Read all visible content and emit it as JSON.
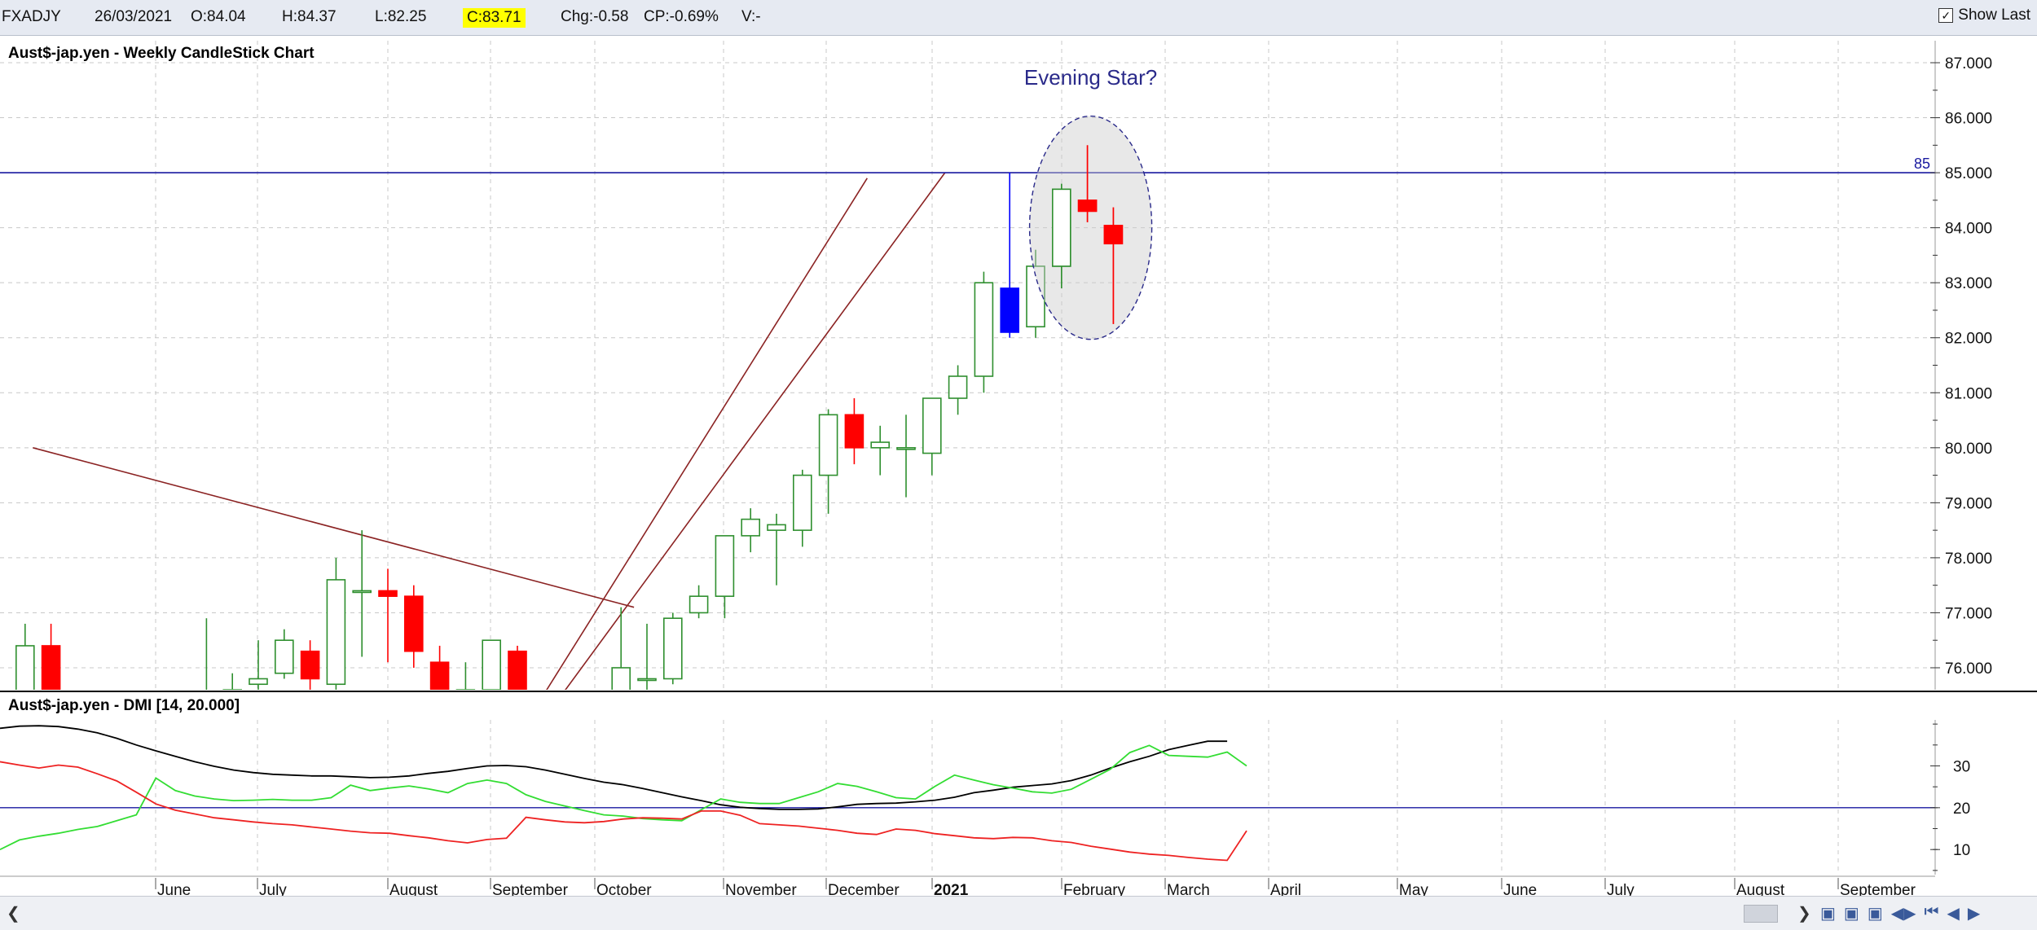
{
  "header": {
    "symbol": "FXADJY",
    "date": "26/03/2021",
    "open": "O:84.04",
    "high": "H:84.37",
    "low": "L:82.25",
    "close": "C:83.71",
    "change": "Chg:-0.58",
    "change_pct": "CP:-0.69%",
    "volume": "V:-",
    "show_last_label": "Show Last",
    "show_last_checked": true
  },
  "colors": {
    "bull": "#2f8f2f",
    "bear": "#ff0000",
    "highlight": "#0000ff",
    "trendline": "#8b2323",
    "resistance": "#1a1aa0",
    "adx": "#000000",
    "plus_di": "#33dd33",
    "minus_di": "#ee2222",
    "grid": "#c8c8c8"
  },
  "chart_data": [
    {
      "type": "candlestick",
      "title": "Aust$-jap.yen - Weekly CandleStick Chart",
      "ylim": [
        75.6,
        87.4
      ],
      "y_ticks": [
        "76.000",
        "77.000",
        "78.000",
        "79.000",
        "80.000",
        "81.000",
        "82.000",
        "83.000",
        "84.000",
        "85.000",
        "86.000",
        "87.000"
      ],
      "x_month_labels": [
        "June",
        "July",
        "August",
        "September",
        "October",
        "November",
        "December",
        "2021",
        "February",
        "March",
        "April",
        "May",
        "June",
        "July",
        "August",
        "September"
      ],
      "grid": true,
      "candles": [
        {
          "o": 75.5,
          "h": 76.8,
          "l": 75.3,
          "c": 76.4
        },
        {
          "o": 76.4,
          "h": 76.8,
          "l": 75.3,
          "c": 75.5
        },
        {
          "o": null,
          "h": null,
          "l": null,
          "c": null
        },
        {
          "o": null,
          "h": null,
          "l": null,
          "c": null
        },
        {
          "o": null,
          "h": null,
          "l": null,
          "c": null
        },
        {
          "o": null,
          "h": null,
          "l": null,
          "c": null
        },
        {
          "o": null,
          "h": null,
          "l": null,
          "c": null
        },
        {
          "o": 75.5,
          "h": 76.9,
          "l": 75.4,
          "c": 75.5
        },
        {
          "o": 75.4,
          "h": 75.9,
          "l": 75.3,
          "c": 75.6
        },
        {
          "o": 75.7,
          "h": 76.5,
          "l": 75.6,
          "c": 75.8
        },
        {
          "o": 75.9,
          "h": 76.7,
          "l": 75.8,
          "c": 76.5
        },
        {
          "o": 76.3,
          "h": 76.5,
          "l": 75.5,
          "c": 75.8
        },
        {
          "o": 75.7,
          "h": 78.0,
          "l": 75.6,
          "c": 77.6
        },
        {
          "o": 77.4,
          "h": 78.5,
          "l": 76.2,
          "c": 77.4
        },
        {
          "o": 77.4,
          "h": 77.8,
          "l": 76.1,
          "c": 77.3
        },
        {
          "o": 77.3,
          "h": 77.5,
          "l": 76.0,
          "c": 76.3
        },
        {
          "o": 76.1,
          "h": 76.4,
          "l": 75.4,
          "c": 75.5
        },
        {
          "o": 75.6,
          "h": 76.1,
          "l": 75.4,
          "c": 75.6
        },
        {
          "o": 75.6,
          "h": 76.5,
          "l": 75.4,
          "c": 76.5
        },
        {
          "o": 76.3,
          "h": 76.4,
          "l": 75.4,
          "c": 75.5
        },
        {
          "o": null,
          "h": null,
          "l": null,
          "c": null
        },
        {
          "o": null,
          "h": null,
          "l": null,
          "c": null
        },
        {
          "o": null,
          "h": null,
          "l": null,
          "c": null
        },
        {
          "o": 75.5,
          "h": 77.1,
          "l": 75.4,
          "c": 76.0
        },
        {
          "o": 75.8,
          "h": 76.8,
          "l": 75.5,
          "c": 75.8
        },
        {
          "o": 75.8,
          "h": 77.0,
          "l": 75.7,
          "c": 76.9
        },
        {
          "o": 77.0,
          "h": 77.5,
          "l": 76.9,
          "c": 77.3
        },
        {
          "o": 77.3,
          "h": 78.4,
          "l": 76.9,
          "c": 78.4
        },
        {
          "o": 78.4,
          "h": 78.9,
          "l": 78.1,
          "c": 78.7
        },
        {
          "o": 78.5,
          "h": 78.8,
          "l": 77.5,
          "c": 78.6
        },
        {
          "o": 78.5,
          "h": 79.6,
          "l": 78.2,
          "c": 79.5
        },
        {
          "o": 79.5,
          "h": 80.7,
          "l": 78.8,
          "c": 80.6
        },
        {
          "o": 80.6,
          "h": 80.9,
          "l": 79.7,
          "c": 80.0
        },
        {
          "o": 80.0,
          "h": 80.4,
          "l": 79.5,
          "c": 80.1
        },
        {
          "o": 80.0,
          "h": 80.6,
          "l": 79.1,
          "c": 80.0
        },
        {
          "o": 79.9,
          "h": 80.9,
          "l": 79.5,
          "c": 80.9
        },
        {
          "o": 80.9,
          "h": 81.5,
          "l": 80.6,
          "c": 81.3
        },
        {
          "o": 81.3,
          "h": 83.2,
          "l": 81.0,
          "c": 83.0
        },
        {
          "o": 82.9,
          "h": 85.0,
          "l": 82.0,
          "c": 82.1,
          "highlight": true
        },
        {
          "o": 82.2,
          "h": 83.6,
          "l": 82.0,
          "c": 83.3
        },
        {
          "o": 83.3,
          "h": 84.8,
          "l": 82.9,
          "c": 84.7
        },
        {
          "o": 84.5,
          "h": 85.5,
          "l": 84.1,
          "c": 84.3
        },
        {
          "o": 84.04,
          "h": 84.37,
          "l": 82.25,
          "c": 83.71
        }
      ],
      "resistance_level": 85,
      "resistance_label": "85",
      "annotation": "Evening Star?"
    },
    {
      "type": "line",
      "title": "Aust$-jap.yen - DMI [14, 20.000]",
      "ylim": [
        4,
        41
      ],
      "y_ticks": [
        "10",
        "20",
        "30"
      ],
      "threshold": 20,
      "series": [
        {
          "key": "adx",
          "values": [
            39,
            39.5,
            39.6,
            39.4,
            38.8,
            37.9,
            36.6,
            35,
            33.6,
            32.3,
            31,
            29.9,
            29,
            28.4,
            28,
            27.8,
            27.6,
            27.6,
            27.4,
            27.2,
            27.3,
            27.6,
            28.2,
            28.7,
            29.4,
            30,
            30.1,
            29.8,
            29,
            28,
            27,
            26.1,
            25.5,
            24.6,
            23.6,
            22.6,
            21.7,
            20.7,
            20.1,
            19.8,
            19.6,
            19.6,
            19.7,
            20.2,
            20.8,
            21,
            21.1,
            21.4,
            21.8,
            22.5,
            23.6,
            24.2,
            24.9,
            25.3,
            25.7,
            26.5,
            27.8,
            29.5,
            31,
            32.3,
            33.9,
            34.9,
            35.9,
            35.9
          ]
        },
        {
          "key": "plus_di",
          "values": [
            10,
            12.3,
            13.2,
            13.9,
            14.8,
            15.5,
            16.9,
            18.3,
            27.1,
            24.1,
            22.8,
            22.1,
            21.7,
            21.8,
            22,
            21.8,
            21.8,
            22.4,
            25.4,
            24.1,
            24.7,
            25.2,
            24.5,
            23.6,
            25.8,
            26.6,
            25.8,
            23.1,
            21.5,
            20.4,
            19.3,
            18.3,
            18,
            17.4,
            17.1,
            16.9,
            19.5,
            22.1,
            21.3,
            21,
            21,
            22.4,
            23.8,
            25.8,
            25.1,
            23.8,
            22.4,
            22.1,
            25.1,
            27.8,
            26.6,
            25.5,
            24.7,
            23.8,
            23.5,
            24.4,
            26.8,
            29.2,
            33.2,
            34.9,
            32.5,
            32.3,
            32.1,
            33.3,
            30
          ]
        },
        {
          "key": "minus_di",
          "values": [
            31,
            30.2,
            29.5,
            30.2,
            29.7,
            28.1,
            26.4,
            23.7,
            20.9,
            19.4,
            18.5,
            17.6,
            17.1,
            16.6,
            16.2,
            15.9,
            15.4,
            14.9,
            14.4,
            14,
            13.9,
            13.3,
            12.8,
            12.1,
            11.6,
            12.4,
            12.7,
            17.7,
            17.1,
            16.6,
            16.4,
            16.7,
            17.3,
            17.6,
            17.5,
            17.3,
            19.2,
            19.2,
            18.2,
            16.2,
            15.9,
            15.6,
            15.1,
            14.6,
            13.9,
            13.6,
            14.9,
            14.6,
            13.8,
            13.3,
            12.8,
            12.6,
            12.9,
            12.8,
            12.1,
            11.7,
            10.8,
            10.1,
            9.4,
            8.9,
            8.6,
            8.1,
            7.7,
            7.4,
            14.5
          ]
        }
      ]
    }
  ]
}
